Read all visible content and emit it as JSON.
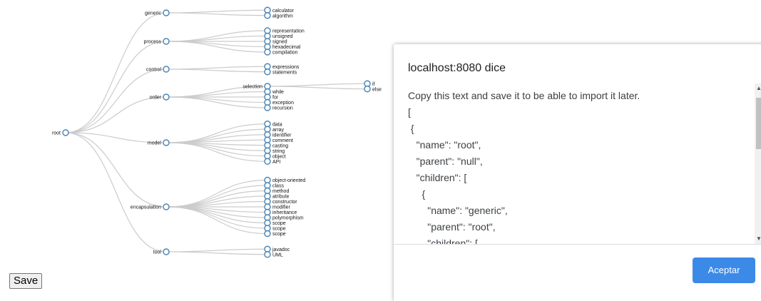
{
  "tree": {
    "root": "root",
    "branches": [
      {
        "name": "generic",
        "children": [
          "calculator",
          "algorithm"
        ]
      },
      {
        "name": "process",
        "children": [
          "representation",
          "unsigned",
          "signed",
          "hexadecimal",
          "compilation"
        ]
      },
      {
        "name": "control",
        "children": [
          "expressions",
          "statements"
        ]
      },
      {
        "name": "order",
        "children": [
          "selection",
          "while",
          "for",
          "exception",
          "recursion"
        ],
        "grandchildren": {
          "selection": [
            "if",
            "else"
          ]
        }
      },
      {
        "name": "model",
        "children": [
          "data",
          "array",
          "identifier",
          "comment",
          "casting",
          "string",
          "object",
          "API"
        ]
      },
      {
        "name": "encapsulation",
        "children": [
          "object-oriented",
          "class",
          "method",
          "atribute",
          "constructor",
          "modifier",
          "inheritance",
          "polymorphism",
          "scope",
          "scope",
          "scope"
        ]
      },
      {
        "name": "tool",
        "children": [
          "javadoc",
          "UML"
        ]
      }
    ]
  },
  "save_button": {
    "label": "Save"
  },
  "dialog": {
    "title": "localhost:8080 dice",
    "message_lines": [
      "Copy this text and save it to be able to import it later.",
      "[",
      " {",
      "   \"name\": \"root\",",
      "   \"parent\": \"null\",",
      "   \"children\": [",
      "     {",
      "       \"name\": \"generic\",",
      "       \"parent\": \"root\",",
      "       \"children\": ["
    ],
    "ok_label": "Aceptar",
    "accent_color": "#3c8ae8"
  },
  "colors": {
    "node_stroke": "#4682b4",
    "link": "#cccccc"
  }
}
